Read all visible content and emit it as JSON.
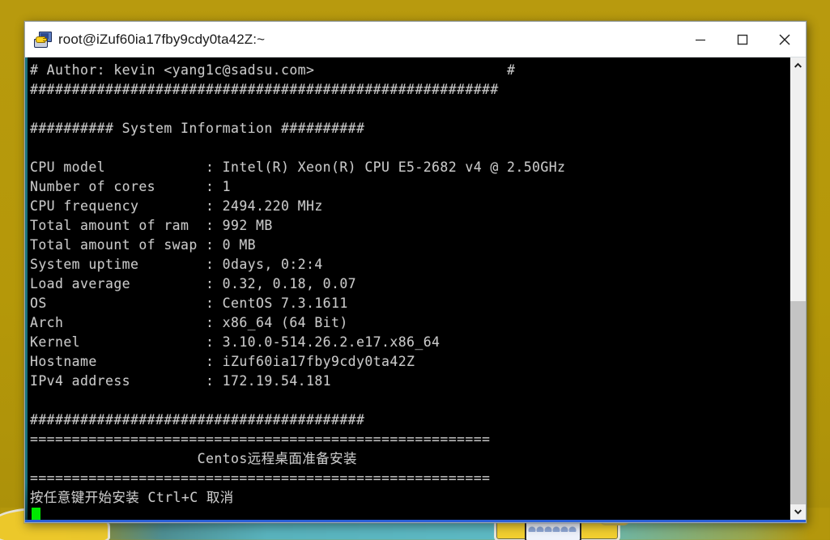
{
  "desktop": {
    "background_color": "#b79a10",
    "wallpaper_accent": "#5fbcc6"
  },
  "window": {
    "title": "root@iZuf60ia17fby9cdy0ta42Z:~",
    "icon": "putty-terminal-icon",
    "controls": {
      "minimize_label": "Minimize",
      "maximize_label": "Maximize",
      "close_label": "Close"
    }
  },
  "terminal": {
    "foreground_color": "#c9c9c9",
    "background_color": "#000000",
    "cursor_color": "#00e800",
    "lines": [
      "# Author: kevin <yang1c@sadsu.com>                       #",
      "########################################################",
      "",
      "########## System Information ##########",
      "",
      "CPU model            : Intel(R) Xeon(R) CPU E5-2682 v4 @ 2.50GHz",
      "Number of cores      : 1",
      "CPU frequency        : 2494.220 MHz",
      "Total amount of ram  : 992 MB",
      "Total amount of swap : 0 MB",
      "System uptime        : 0days, 0:2:4",
      "Load average         : 0.32, 0.18, 0.07",
      "OS                   : CentOS 7.3.1611",
      "Arch                 : x86_64 (64 Bit)",
      "Kernel               : 3.10.0-514.26.2.e17.x86_64",
      "Hostname             : iZuf60ia17fby9cdy0ta42Z",
      "IPv4 address         : 172.19.54.181",
      "",
      "########################################",
      "=======================================================",
      "                    Centos远程桌面准备安装",
      "=======================================================",
      "按任意键开始安装 Ctrl+C 取消"
    ],
    "header_author": "# Author: kevin <yang1c@sadsu.com>",
    "section_title": "########## System Information ##########",
    "system_info": [
      {
        "label": "CPU model",
        "value": "Intel(R) Xeon(R) CPU E5-2682 v4 @ 2.50GHz"
      },
      {
        "label": "Number of cores",
        "value": "1"
      },
      {
        "label": "CPU frequency",
        "value": "2494.220 MHz"
      },
      {
        "label": "Total amount of ram",
        "value": "992 MB"
      },
      {
        "label": "Total amount of swap",
        "value": "0 MB"
      },
      {
        "label": "System uptime",
        "value": "0days, 0:2:4"
      },
      {
        "label": "Load average",
        "value": "0.32, 0.18, 0.07"
      },
      {
        "label": "OS",
        "value": "CentOS 7.3.1611"
      },
      {
        "label": "Arch",
        "value": "x86_64 (64 Bit)"
      },
      {
        "label": "Kernel",
        "value": "3.10.0-514.26.2.e17.x86_64"
      },
      {
        "label": "Hostname",
        "value": "iZuf60ia17fby9cdy0ta42Z"
      },
      {
        "label": "IPv4 address",
        "value": "172.19.54.181"
      }
    ],
    "banner_title": "Centos远程桌面准备安装",
    "prompt_line": "按任意键开始安装 Ctrl+C 取消",
    "cursor_visible": true
  },
  "scrollbar": {
    "up_arrow": "chevron-up-icon",
    "down_arrow": "chevron-down-icon",
    "thumb_position_percent": 53
  }
}
